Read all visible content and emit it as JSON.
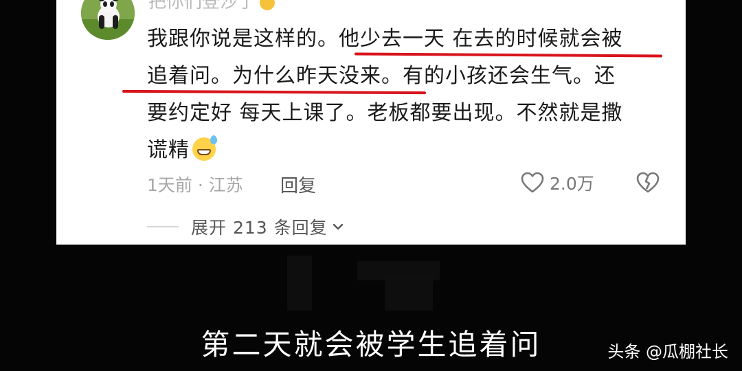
{
  "comment": {
    "username": "把你们登沙了",
    "lines": [
      "我跟你说是这样的。他少去一天 在去的时候就会被",
      "追着问。为什么昨天没来。有的小孩还会生气。还",
      "要约定好 每天上课了。老板都要出现。不然就是撒",
      "谎精"
    ],
    "emoji": "grinning-sweat-emoji",
    "meta": "1天前 · 江苏",
    "reply_label": "回复",
    "likes": "2.0万",
    "expand_label": "展开 213 条回复"
  },
  "subtitle": "第二天就会被学生追着问",
  "watermark": "头条 @瓜棚社长",
  "colors": {
    "underline": "#d8141c",
    "card": "#ffffff",
    "background": "#050505"
  },
  "icons": {
    "like": "heart-outline-icon",
    "dislike": "broken-heart-icon",
    "expand": "chevron-down-icon"
  }
}
